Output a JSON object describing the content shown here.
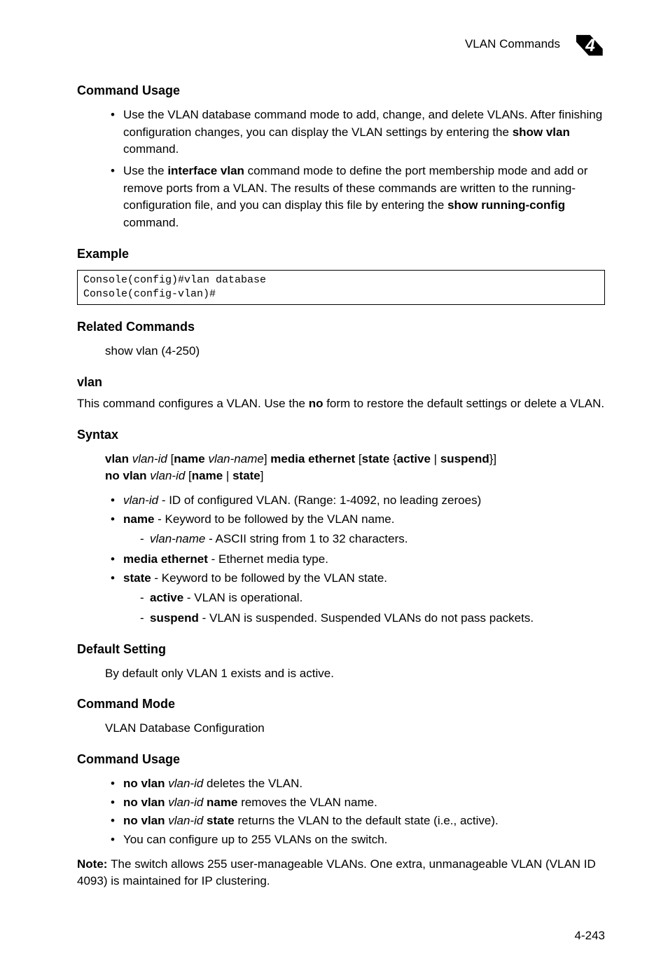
{
  "header": {
    "section_title": "VLAN Commands",
    "chapter_number": "4"
  },
  "command_usage_1": {
    "heading": "Command Usage",
    "b1_part1": "Use the VLAN database command mode to add, change, and delete VLANs. After finishing configuration changes, you can display the VLAN settings by entering the ",
    "b1_bold": "show vlan",
    "b1_part2": " command.",
    "b2_part1": "Use the ",
    "b2_bold1": "interface vlan",
    "b2_part2": " command mode to define the port membership mode and add or remove ports from a VLAN. The results of these commands are written to the running-configuration file, and you can display this file by entering the ",
    "b2_bold2": "show running-config",
    "b2_part3": " command."
  },
  "example": {
    "heading": "Example",
    "code": "Console(config)#vlan database\nConsole(config-vlan)#"
  },
  "related": {
    "heading": "Related Commands",
    "text": "show vlan (4-250)"
  },
  "vlan_cmd": {
    "name": "vlan",
    "desc_part1": "This command configures a VLAN. Use the ",
    "desc_bold": "no",
    "desc_part2": " form to restore the default settings or delete a VLAN."
  },
  "syntax": {
    "heading": "Syntax",
    "l1_b1": "vlan ",
    "l1_i1": "vlan-id",
    "l1_t1": " [",
    "l1_b2": "name ",
    "l1_i2": "vlan-name",
    "l1_t2": "] ",
    "l1_b3": "media ethernet",
    "l1_t3": " [",
    "l1_b4": "state",
    "l1_t4": " {",
    "l1_b5": "active",
    "l1_t5": " | ",
    "l1_b6": "suspend",
    "l1_t6": "}]",
    "l2_b1": "no vlan ",
    "l2_i1": "vlan-id",
    "l2_t1": " [",
    "l2_b2": "name",
    "l2_t2": " | ",
    "l2_b3": "state",
    "l2_t3": "]"
  },
  "syntax_bullets": {
    "b1_i": "vlan-id",
    "b1_t": " - ID of configured VLAN. (Range: 1-4092, no leading zeroes)",
    "b2_b": "name",
    "b2_t": " - Keyword to be followed by the VLAN name.",
    "b2_d1_i": "vlan-name",
    "b2_d1_t": " - ASCII string from 1 to 32 characters.",
    "b3_b": "media ethernet",
    "b3_t": " - Ethernet media type.",
    "b4_b": "state",
    "b4_t": " - Keyword to be followed by the VLAN state.",
    "b4_d1_b": "active",
    "b4_d1_t": " - VLAN is operational.",
    "b4_d2_b": "suspend",
    "b4_d2_t": " - VLAN is suspended. Suspended VLANs do not pass packets."
  },
  "default_setting": {
    "heading": "Default Setting",
    "text": "By default only VLAN 1 exists and is active."
  },
  "command_mode": {
    "heading": "Command Mode",
    "text": "VLAN Database Configuration"
  },
  "command_usage_2": {
    "heading": "Command Usage",
    "b1_b1": "no vlan ",
    "b1_i1": "vlan-id",
    "b1_t1": " deletes the VLAN.",
    "b2_b1": "no vlan ",
    "b2_i1": "vlan-id ",
    "b2_b2": "name",
    "b2_t1": " removes the VLAN name.",
    "b3_b1": "no vlan ",
    "b3_i1": "vlan-id ",
    "b3_b2": "state",
    "b3_t1": " returns the VLAN to the default state (i.e., active).",
    "b4_t": "You can configure up to 255 VLANs on the switch."
  },
  "note": {
    "label": "Note: ",
    "text": "The switch allows 255 user-manageable VLANs. One extra, unmanageable VLAN (VLAN ID 4093) is maintained for IP clustering."
  },
  "page_number": "4-243"
}
